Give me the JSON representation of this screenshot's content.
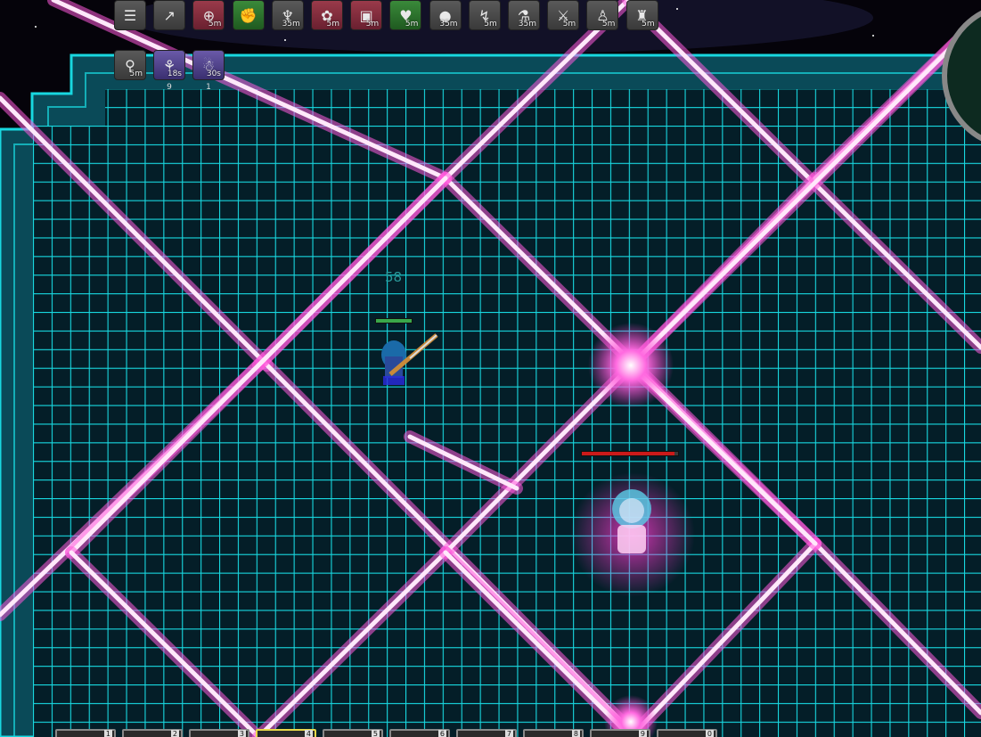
{
  "buffs_top": [
    {
      "icon": "quest-list-icon",
      "color": "gray",
      "timer": ""
    },
    {
      "icon": "party-up-icon",
      "color": "gray",
      "timer": ""
    },
    {
      "icon": "crosshair-icon",
      "color": "red",
      "timer": "5m"
    },
    {
      "icon": "fist-icon",
      "color": "green",
      "timer": ""
    },
    {
      "icon": "wheat-icon",
      "color": "gray",
      "timer": "35m"
    },
    {
      "icon": "flower-icon",
      "color": "red",
      "timer": "5m"
    },
    {
      "icon": "box-icon",
      "color": "red",
      "timer": "5m"
    },
    {
      "icon": "heart-icon",
      "color": "green",
      "timer": "5m"
    },
    {
      "icon": "orb-icon",
      "color": "gray",
      "timer": "35m"
    },
    {
      "icon": "swing-icon",
      "color": "gray",
      "timer": "5m"
    },
    {
      "icon": "potion-icon",
      "color": "gray",
      "timer": "35m"
    },
    {
      "icon": "sword-icon",
      "color": "gray",
      "timer": "5m"
    },
    {
      "icon": "figure-icon",
      "color": "gray",
      "timer": "5m"
    },
    {
      "icon": "tower-icon",
      "color": "gray",
      "timer": "5m"
    }
  ],
  "buffs_second": [
    {
      "icon": "runner-icon",
      "color": "gray",
      "timer": "5m",
      "stack": ""
    },
    {
      "icon": "feather-icon",
      "color": "purple",
      "timer": "18s",
      "stack": "9"
    },
    {
      "icon": "ghost-icon",
      "color": "purple",
      "timer": "30s",
      "stack": "1"
    }
  ],
  "damage_number": "58",
  "player": {
    "health_fraction": 1.0,
    "bar_color": "#3aa84a"
  },
  "boss": {
    "health_fraction": 0.96,
    "bar_color": "#cc1a1a"
  },
  "hotbar": [
    "1",
    "2",
    "3",
    "4",
    "5",
    "6",
    "7",
    "8",
    "9",
    "0"
  ],
  "hotbar_selected": 3,
  "colors": {
    "grid": "#18d8e0",
    "arena_bg": "#041e28",
    "laser": "#ff5adc",
    "space": "#05030a"
  }
}
